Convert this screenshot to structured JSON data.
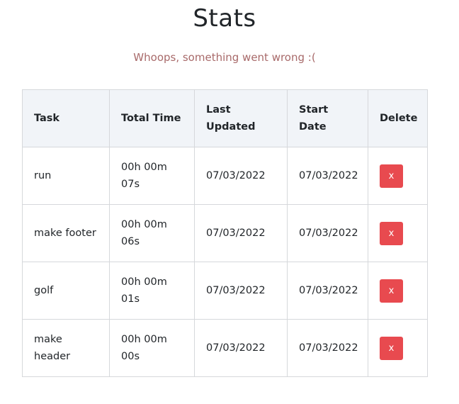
{
  "page": {
    "title": "Stats",
    "error_message": "Whoops, something went wrong :("
  },
  "table": {
    "headers": {
      "task": "Task",
      "total_time": "Total Time",
      "last_updated": "Last Updated",
      "start_date": "Start Date",
      "delete": "Delete"
    },
    "rows": [
      {
        "task": "run",
        "total_time": "00h 00m 07s",
        "last_updated": "07/03/2022",
        "start_date": "07/03/2022",
        "delete_label": "x"
      },
      {
        "task": "make footer",
        "total_time": "00h 00m 06s",
        "last_updated": "07/03/2022",
        "start_date": "07/03/2022",
        "delete_label": "x"
      },
      {
        "task": "golf",
        "total_time": "00h 00m 01s",
        "last_updated": "07/03/2022",
        "start_date": "07/03/2022",
        "delete_label": "x"
      },
      {
        "task": "make header",
        "total_time": "00h 00m 00s",
        "last_updated": "07/03/2022",
        "start_date": "07/03/2022",
        "delete_label": "x"
      }
    ]
  },
  "colors": {
    "delete_button": "#e84a4f",
    "header_background": "#f1f4f8",
    "error_text": "#a86a6a"
  }
}
